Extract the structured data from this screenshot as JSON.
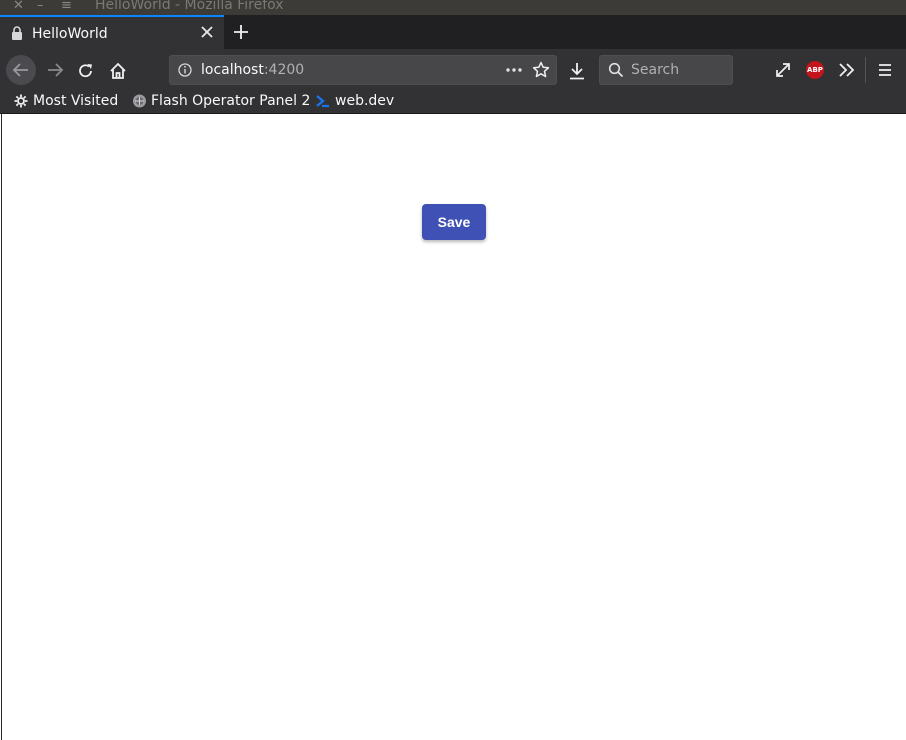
{
  "window": {
    "title": "HelloWorld - Mozilla Firefox",
    "controls": [
      "close-icon",
      "minimize-icon",
      "maximize-icon"
    ]
  },
  "tabs": [
    {
      "title": "HelloWorld",
      "icon": "lock-icon"
    }
  ],
  "navbar": {
    "url_host": "localhost",
    "url_port": ":4200",
    "search_placeholder": "Search",
    "abp_label": "ABP"
  },
  "bookmarks": [
    {
      "label": "Most Visited",
      "icon": "gear-icon"
    },
    {
      "label": "Flash Operator Panel 2",
      "icon": "panel-icon"
    },
    {
      "label": "web.dev",
      "icon": "webdev-icon"
    }
  ],
  "page": {
    "save_label": "Save"
  },
  "colors": {
    "accent": "#3f51b5",
    "toolbar": "#323234",
    "tab_highlight": "#0a84ff"
  }
}
